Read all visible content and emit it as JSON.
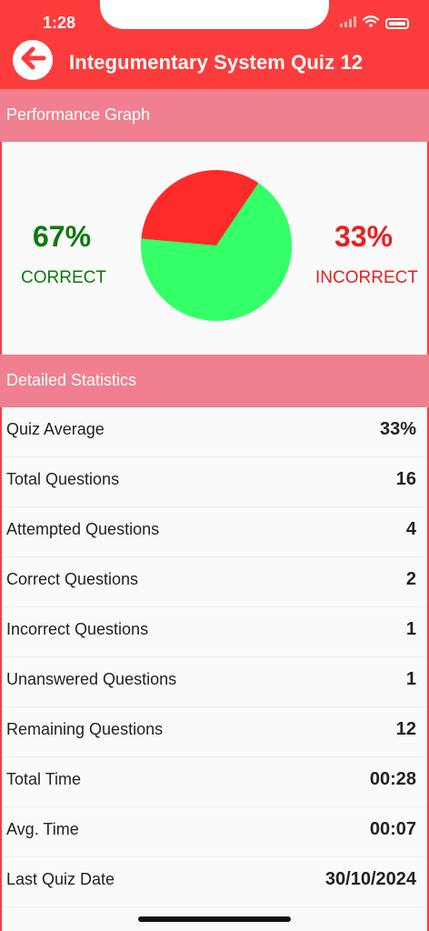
{
  "status_bar": {
    "time": "1:28"
  },
  "header": {
    "title": "Integumentary System Quiz 12"
  },
  "performance": {
    "section_title": "Performance Graph",
    "correct_pct": "67%",
    "correct_label": "CORRECT",
    "incorrect_pct": "33%",
    "incorrect_label": "INCORRECT",
    "colors": {
      "correct": "#33ff66",
      "incorrect": "#ff2a2a",
      "correct_text": "#0a7a0a",
      "incorrect_text": "#e82020"
    }
  },
  "chart_data": {
    "type": "pie",
    "categories": [
      "CORRECT",
      "INCORRECT"
    ],
    "values": [
      67,
      33
    ],
    "colors": [
      "#33ff66",
      "#ff2a2a"
    ]
  },
  "stats": {
    "section_title": "Detailed Statistics",
    "rows": [
      {
        "label": "Quiz Average",
        "value": "33%"
      },
      {
        "label": "Total Questions",
        "value": "16"
      },
      {
        "label": "Attempted Questions",
        "value": "4"
      },
      {
        "label": "Correct Questions",
        "value": "2"
      },
      {
        "label": "Incorrect Questions",
        "value": "1"
      },
      {
        "label": "Unanswered Questions",
        "value": "1"
      },
      {
        "label": "Remaining Questions",
        "value": "12"
      },
      {
        "label": "Total Time",
        "value": "00:28"
      },
      {
        "label": "Avg. Time",
        "value": "00:07"
      },
      {
        "label": "Last Quiz Date",
        "value": "30/10/2024"
      }
    ]
  }
}
